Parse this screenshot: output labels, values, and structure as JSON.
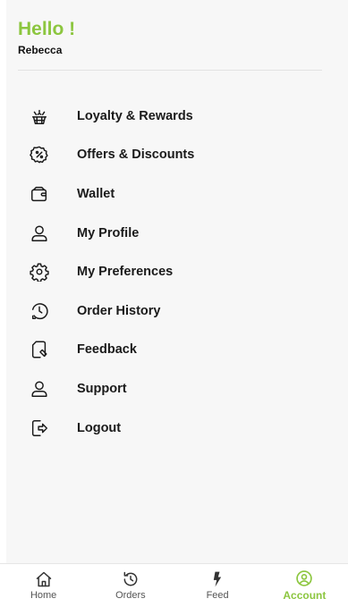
{
  "header": {
    "greeting": "Hello !",
    "username": "Rebecca"
  },
  "menu": {
    "items": [
      {
        "label": "Loyalty & Rewards",
        "icon": "gift-rewards-icon"
      },
      {
        "label": "Offers & Discounts",
        "icon": "discount-badge-icon"
      },
      {
        "label": "Wallet",
        "icon": "wallet-icon"
      },
      {
        "label": "My Profile",
        "icon": "user-icon"
      },
      {
        "label": "My Preferences",
        "icon": "gear-icon"
      },
      {
        "label": "Order History",
        "icon": "history-icon"
      },
      {
        "label": "Feedback",
        "icon": "feedback-icon"
      },
      {
        "label": "Support",
        "icon": "support-user-icon"
      },
      {
        "label": "Logout",
        "icon": "logout-icon"
      }
    ]
  },
  "bottom_nav": {
    "items": [
      {
        "label": "Home",
        "icon": "home-icon",
        "active": false
      },
      {
        "label": "Orders",
        "icon": "orders-history-icon",
        "active": false
      },
      {
        "label": "Feed",
        "icon": "lightning-icon",
        "active": false
      },
      {
        "label": "Account",
        "icon": "account-icon",
        "active": true
      }
    ]
  },
  "colors": {
    "accent": "#8cc63f",
    "text": "#1a1a1a",
    "panel_bg": "#f7f7f7"
  }
}
